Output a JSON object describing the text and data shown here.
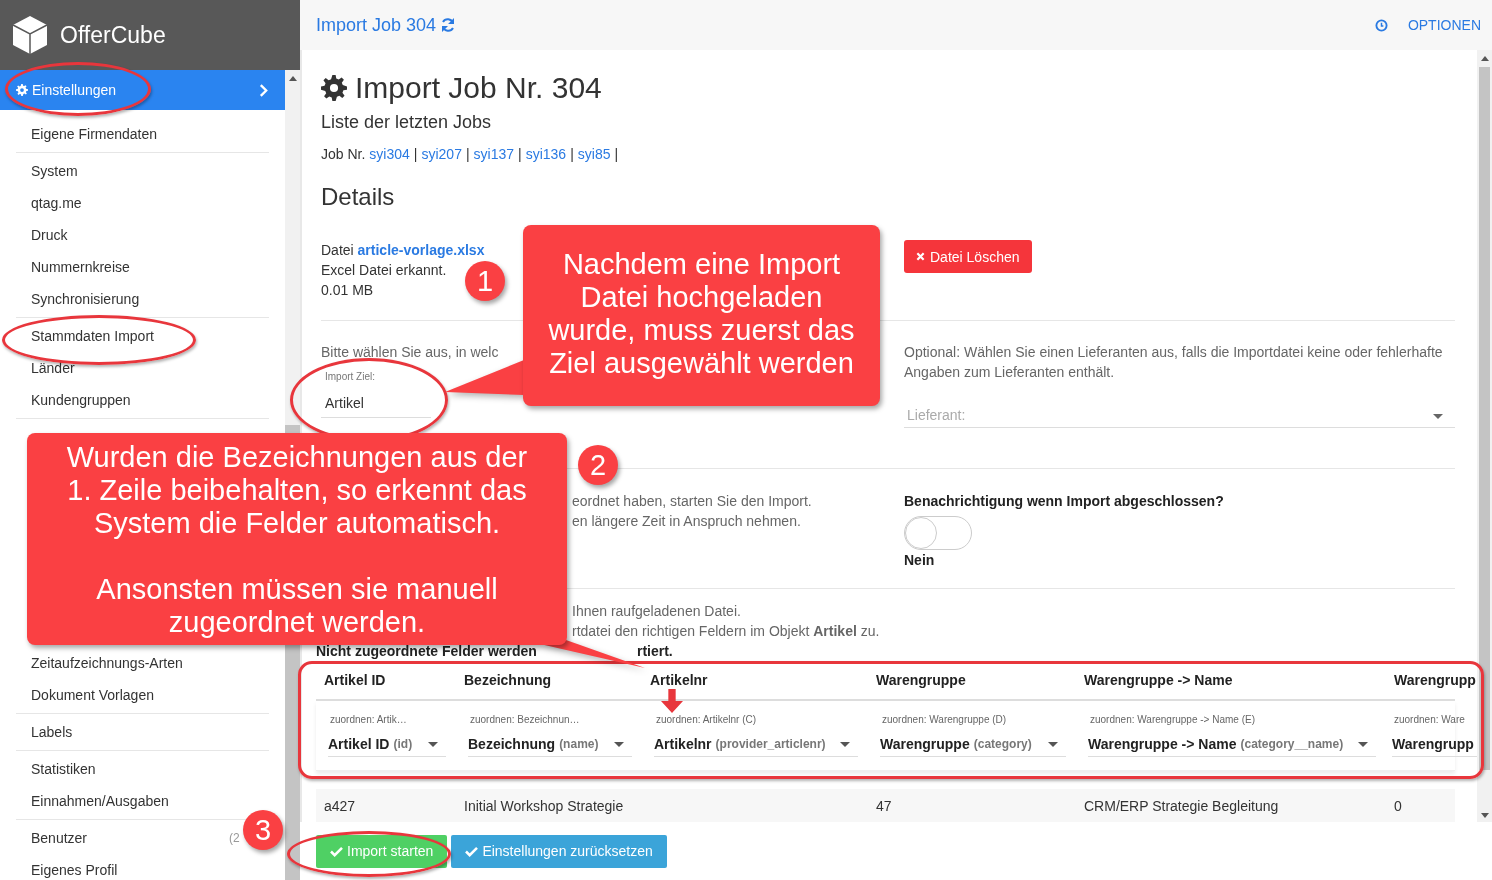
{
  "app": {
    "name": "OfferCube"
  },
  "topbar": {
    "title": "Import Job 304",
    "options": "OPTIONEN"
  },
  "sidebar": {
    "active": {
      "label": "Einstellungen",
      "selected": true
    },
    "groups": [
      {
        "items": [
          {
            "label": "Eigene Firmendaten"
          }
        ]
      },
      {
        "items": [
          {
            "label": "System"
          },
          {
            "label": "qtag.me"
          },
          {
            "label": "Druck"
          },
          {
            "label": "Nummernkreise"
          },
          {
            "label": "Synchronisierung"
          }
        ]
      },
      {
        "items": [
          {
            "label": "Stammdaten Import"
          },
          {
            "label": "Länder"
          },
          {
            "label": "Kundengruppen"
          }
        ]
      },
      {
        "items": [
          {
            "label": "Zeitaufzeichnungs-Arten"
          },
          {
            "label": "Dokument Vorlagen"
          }
        ]
      },
      {
        "items": [
          {
            "label": "Labels"
          }
        ]
      },
      {
        "items": [
          {
            "label": "Statistiken"
          },
          {
            "label": "Einnahmen/Ausgaben"
          }
        ]
      },
      {
        "items": [
          {
            "label": "Benutzer",
            "count": "(2"
          },
          {
            "label": "Eigenes Profil"
          }
        ]
      }
    ]
  },
  "page": {
    "title": "Import Job Nr. 304",
    "subtitle": "Liste der letzten Jobs",
    "jobs_label": "Job Nr.",
    "jobs": [
      "syi304",
      "syi207",
      "syi137",
      "syi136",
      "syi85"
    ],
    "jobs_separator": "|",
    "details_heading": "Details",
    "file": {
      "label": "Datei",
      "name": "article-vorlage.xlsx",
      "type_note": "Excel Datei erkannt.",
      "size": "0.01 MB"
    },
    "delete_button": "Datei Löschen",
    "target": {
      "prompt": "Bitte wählen Sie aus, in welc",
      "label": "Import Ziel:",
      "value": "Artikel"
    },
    "supplier": {
      "note": "Optional: Wählen Sie einen Lieferanten aus, falls die Importdatei keine oder fehlerhafte Angaben zum Lieferanten enthält.",
      "placeholder": "Lieferant:"
    },
    "start_note": [
      "eordnet haben, starten Sie den Import.",
      "en längere Zeit in Anspruch nehmen."
    ],
    "notification": {
      "label": "Benachrichtigung wenn Import abgeschlossen?",
      "on": false,
      "value": "Nein"
    },
    "mapping_note": [
      "Ihnen raufgeladenen Datei.",
      "rtdatei den richtigen Feldern im Objekt **Artikel** zu."
    ],
    "warning": [
      "Nicht zugeordnete Felder werden",
      "rtiert."
    ]
  },
  "table": {
    "columns": [
      {
        "heading": "Artikel ID",
        "hint": "zuordnen: Artik…",
        "field": "Artikel ID",
        "key": "(id)"
      },
      {
        "heading": "Bezeichnung",
        "hint": "zuordnen: Bezeichnun…",
        "field": "Bezeichnung",
        "key": "(name)"
      },
      {
        "heading": "Artikelnr",
        "hint": "zuordnen: Artikelnr (C)",
        "field": "Artikelnr",
        "key": "(provider_articlenr)"
      },
      {
        "heading": "Warengruppe",
        "hint": "zuordnen: Warengruppe (D)",
        "field": "Warengruppe",
        "key": "(category)"
      },
      {
        "heading": "Warengruppe -> Name",
        "hint": "zuordnen: Warengruppe -> Name (E)",
        "field": "Warengruppe -> Name",
        "key": "(category__name)"
      },
      {
        "heading": "Warengrupp",
        "hint": "zuordnen: Ware",
        "field": "Warengrupp"
      }
    ],
    "rows": [
      [
        "a427",
        "Initial Workshop Strategie",
        null,
        "47",
        "CRM/ERP Strategie Begleitung",
        "0"
      ]
    ]
  },
  "buttons": {
    "start": "Import starten",
    "reset": "Einstellungen zurücksetzen"
  },
  "annotations": {
    "callouts": [
      {
        "paragraphs": [
          "Nachdem eine Import Datei hochgeladen wurde, muss zuerst das Ziel ausgewählt werden"
        ]
      },
      {
        "paragraphs": [
          "Wurden die Bezeichnungen aus der 1. Zeile beibehalten, so erkennt das System die Felder automatisch.",
          "Ansonsten müssen sie manuell zugeordnet werden."
        ]
      }
    ],
    "badges": [
      "1",
      "2",
      "3"
    ]
  }
}
